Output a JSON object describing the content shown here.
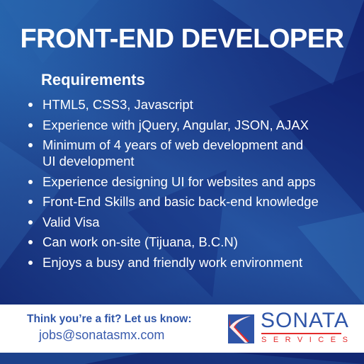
{
  "title": "FRONT-END DEVELOPER",
  "requirements": {
    "heading": "Requirements",
    "items": [
      "HTML5, CSS3, Javascript",
      "Experience with jQuery, Angular, JSON, AJAX",
      "Minimum of 4 years of web development and UI development",
      "Experience designing UI for websites and apps",
      "Front-End Skills and basic back-end knowledge",
      "Valid Visa",
      "Can work on-site (Tijuana, B.C.N)",
      "Enjoys a busy and friendly work environment"
    ]
  },
  "footer": {
    "cta": "Think you’re a fit? Let us know:",
    "email": "jobs@sonatasmx.com",
    "logo": {
      "name": "SONATA",
      "sub": "SERVICES"
    }
  },
  "colors": {
    "background": "#17307f",
    "brand_blue": "#2f55a8",
    "brand_red": "#e32b2b"
  }
}
